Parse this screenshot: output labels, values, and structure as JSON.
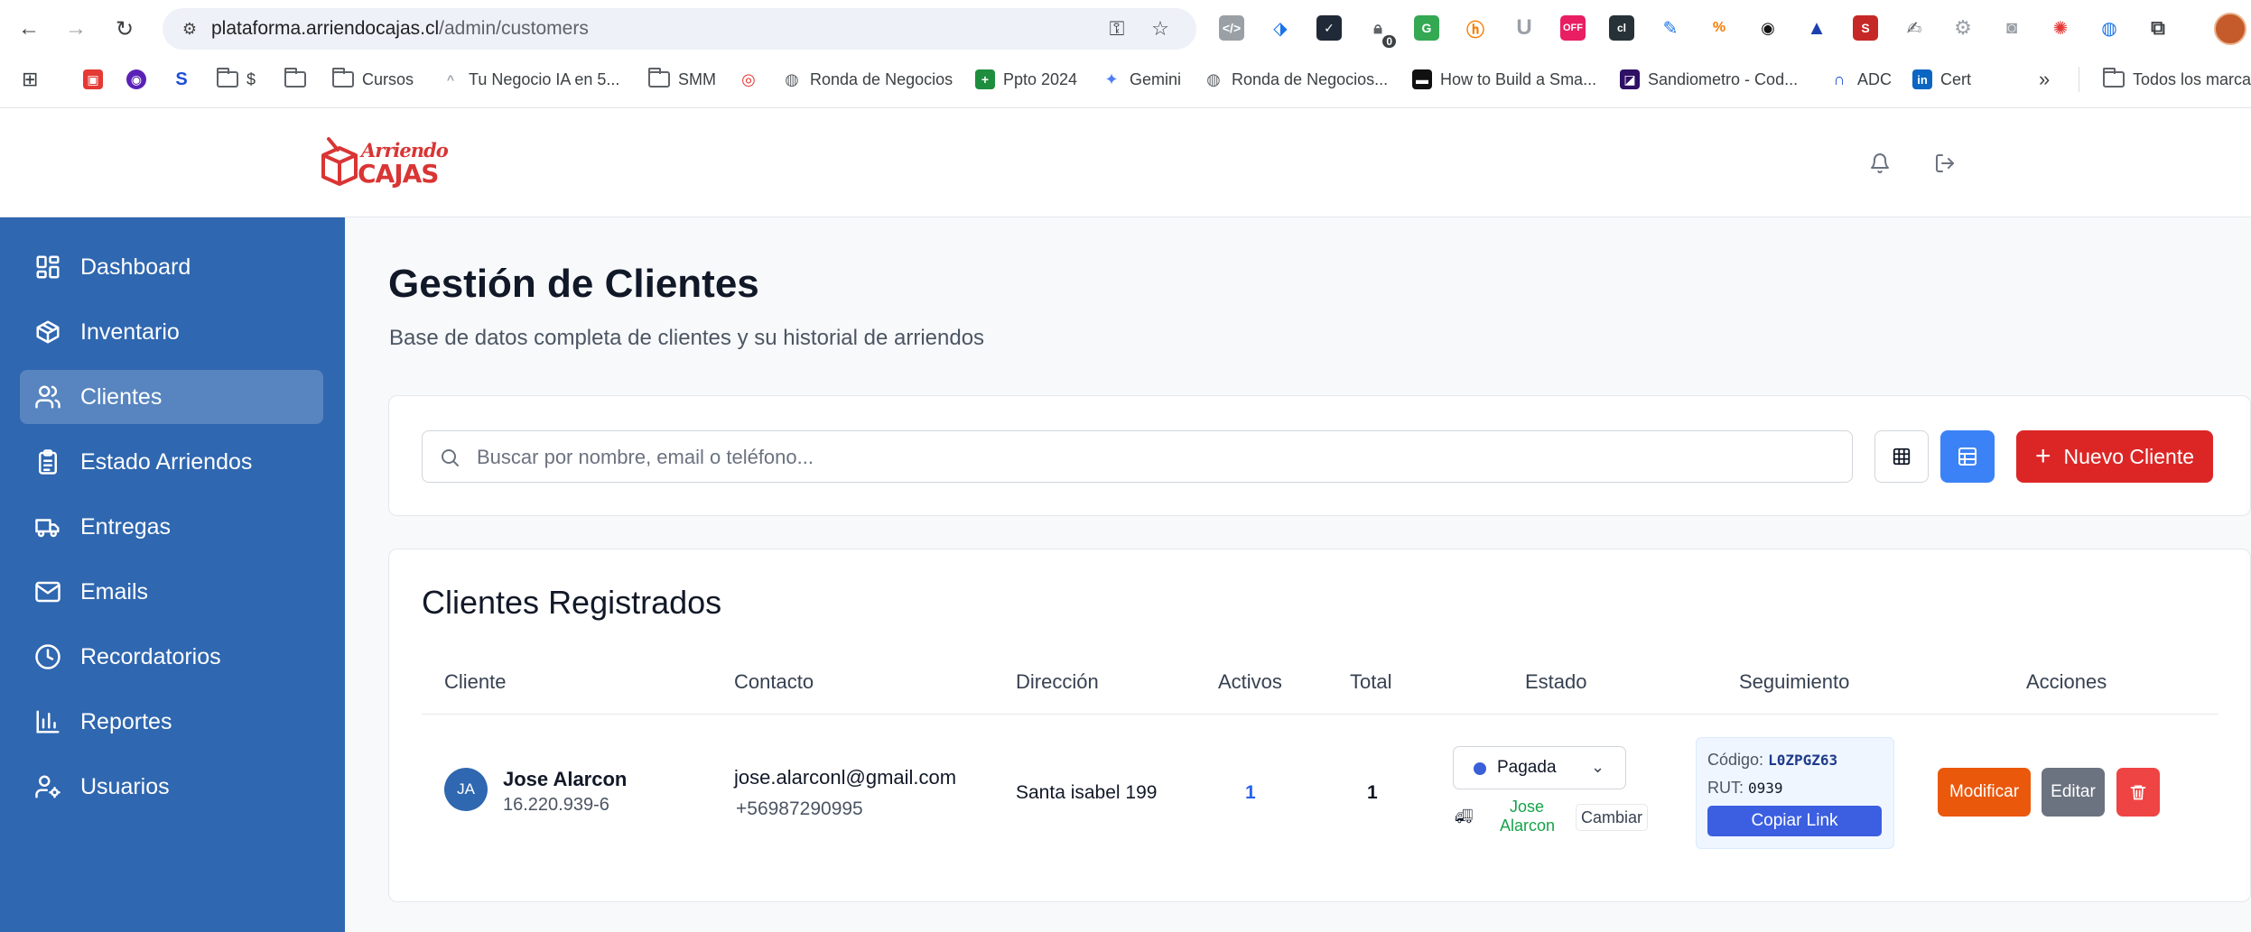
{
  "browser": {
    "url_main": "plataforma.arriendocajas.cl",
    "url_path": "/admin/customers",
    "bookmarks": [
      "$",
      "Cursos",
      "Tu Negocio IA en 5...",
      "SMM",
      "Ronda de Negocios",
      "Ppto 2024",
      "Gemini",
      "Ronda de Negocios...",
      "How to Build a Sma...",
      "Sandiometro - Cod...",
      "ADC",
      "Cert",
      "Todos los marca"
    ],
    "ext_badge_count": "0",
    "ext_badge_off": "OFF"
  },
  "brand": {
    "line1": "Arriendo",
    "line2": "CAJAS"
  },
  "sidebar": {
    "items": [
      {
        "label": "Dashboard",
        "icon": "dashboard-icon"
      },
      {
        "label": "Inventario",
        "icon": "box-icon"
      },
      {
        "label": "Clientes",
        "icon": "users-icon"
      },
      {
        "label": "Estado Arriendos",
        "icon": "clipboard-icon"
      },
      {
        "label": "Entregas",
        "icon": "truck-icon"
      },
      {
        "label": "Emails",
        "icon": "mail-icon"
      },
      {
        "label": "Recordatorios",
        "icon": "clock-icon"
      },
      {
        "label": "Reportes",
        "icon": "bar-chart-icon"
      },
      {
        "label": "Usuarios",
        "icon": "user-cog-icon"
      }
    ],
    "active": "Clientes"
  },
  "page": {
    "title": "Gestión de Clientes",
    "subtitle": "Base de datos completa de clientes y su historial de arriendos"
  },
  "search": {
    "placeholder": "Buscar por nombre, email o teléfono...",
    "new_button": "Nuevo Cliente"
  },
  "table": {
    "title": "Clientes Registrados",
    "headers": [
      "Cliente",
      "Contacto",
      "Dirección",
      "Activos",
      "Total",
      "Estado",
      "Seguimiento",
      "Acciones"
    ],
    "rows": [
      {
        "initials": "JA",
        "name": "Jose Alarcon",
        "rut": "16.220.939-6",
        "email": "jose.alarconl@gmail.com",
        "phone": "+56987290995",
        "address": "Santa isabel 199",
        "activos": "1",
        "total": "1",
        "estado": "Pagada",
        "driver_first": "Jose",
        "driver_last": "Alarcon",
        "cambiar": "Cambiar",
        "codigo_label": "Código:",
        "codigo": "L0ZPGZ63",
        "rut_label": "RUT:",
        "rut_short": "0939",
        "copiar": "Copiar Link",
        "modificar": "Modificar",
        "editar": "Editar"
      }
    ]
  },
  "colors": {
    "sidebar": "#2f67b0",
    "primary_red": "#dc2626",
    "accent_blue": "#3b82f6",
    "modificar": "#ea580c",
    "editar": "#6b7280",
    "delete": "#ef4444"
  }
}
